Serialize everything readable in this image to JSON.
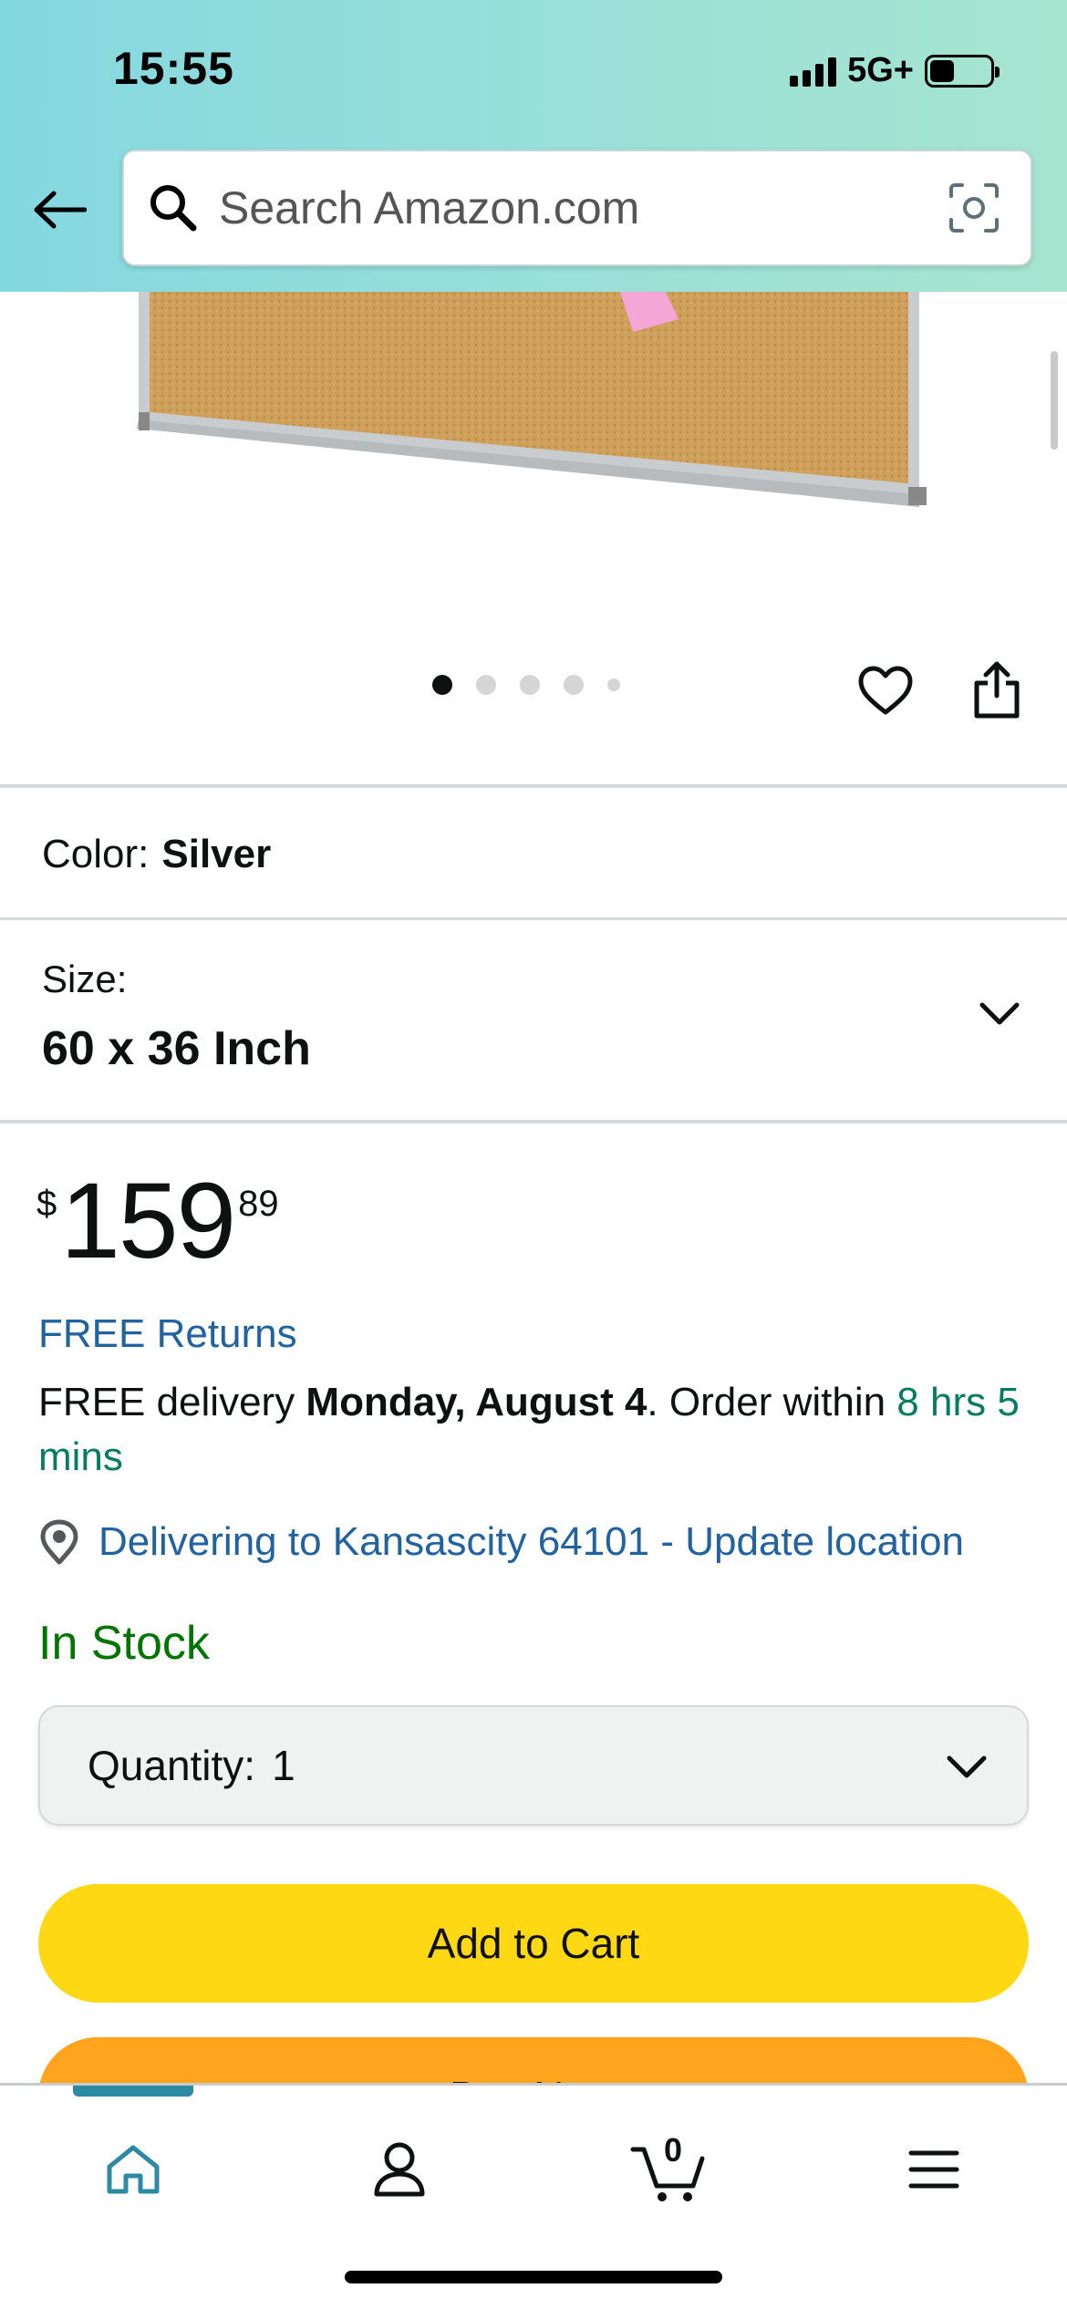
{
  "status_bar": {
    "time": "15:55",
    "network": "5G+"
  },
  "search": {
    "placeholder": "Search Amazon.com"
  },
  "gallery": {
    "dot_count": 5,
    "active_index": 0
  },
  "color": {
    "label": "Color:",
    "value": "Silver"
  },
  "size": {
    "label": "Size:",
    "value": "60 x 36 Inch"
  },
  "price": {
    "symbol": "$",
    "whole": "159",
    "fraction": "89"
  },
  "returns": {
    "label": "FREE Returns"
  },
  "delivery": {
    "prefix": "FREE delivery ",
    "date": "Monday, August 4",
    "middle": ". Order within ",
    "countdown": "8 hrs 5 mins"
  },
  "location": {
    "label": "Delivering to Kansascity 64101 - Update location"
  },
  "stock": {
    "label": "In Stock"
  },
  "quantity": {
    "label": "Quantity:",
    "value": "1"
  },
  "buttons": {
    "add_to_cart": "Add to Cart",
    "buy_now": "Buy Now"
  },
  "bottom_nav": {
    "cart_count": "0",
    "items": [
      "home-icon",
      "account-icon",
      "cart-icon",
      "menu-icon"
    ]
  },
  "colors": {
    "accent_teal": "#2d8aa4",
    "link_blue": "#2162a1",
    "stock_green": "#007600",
    "add_to_cart_yellow": "#ffd814",
    "buy_now_orange": "#ffa41c"
  }
}
